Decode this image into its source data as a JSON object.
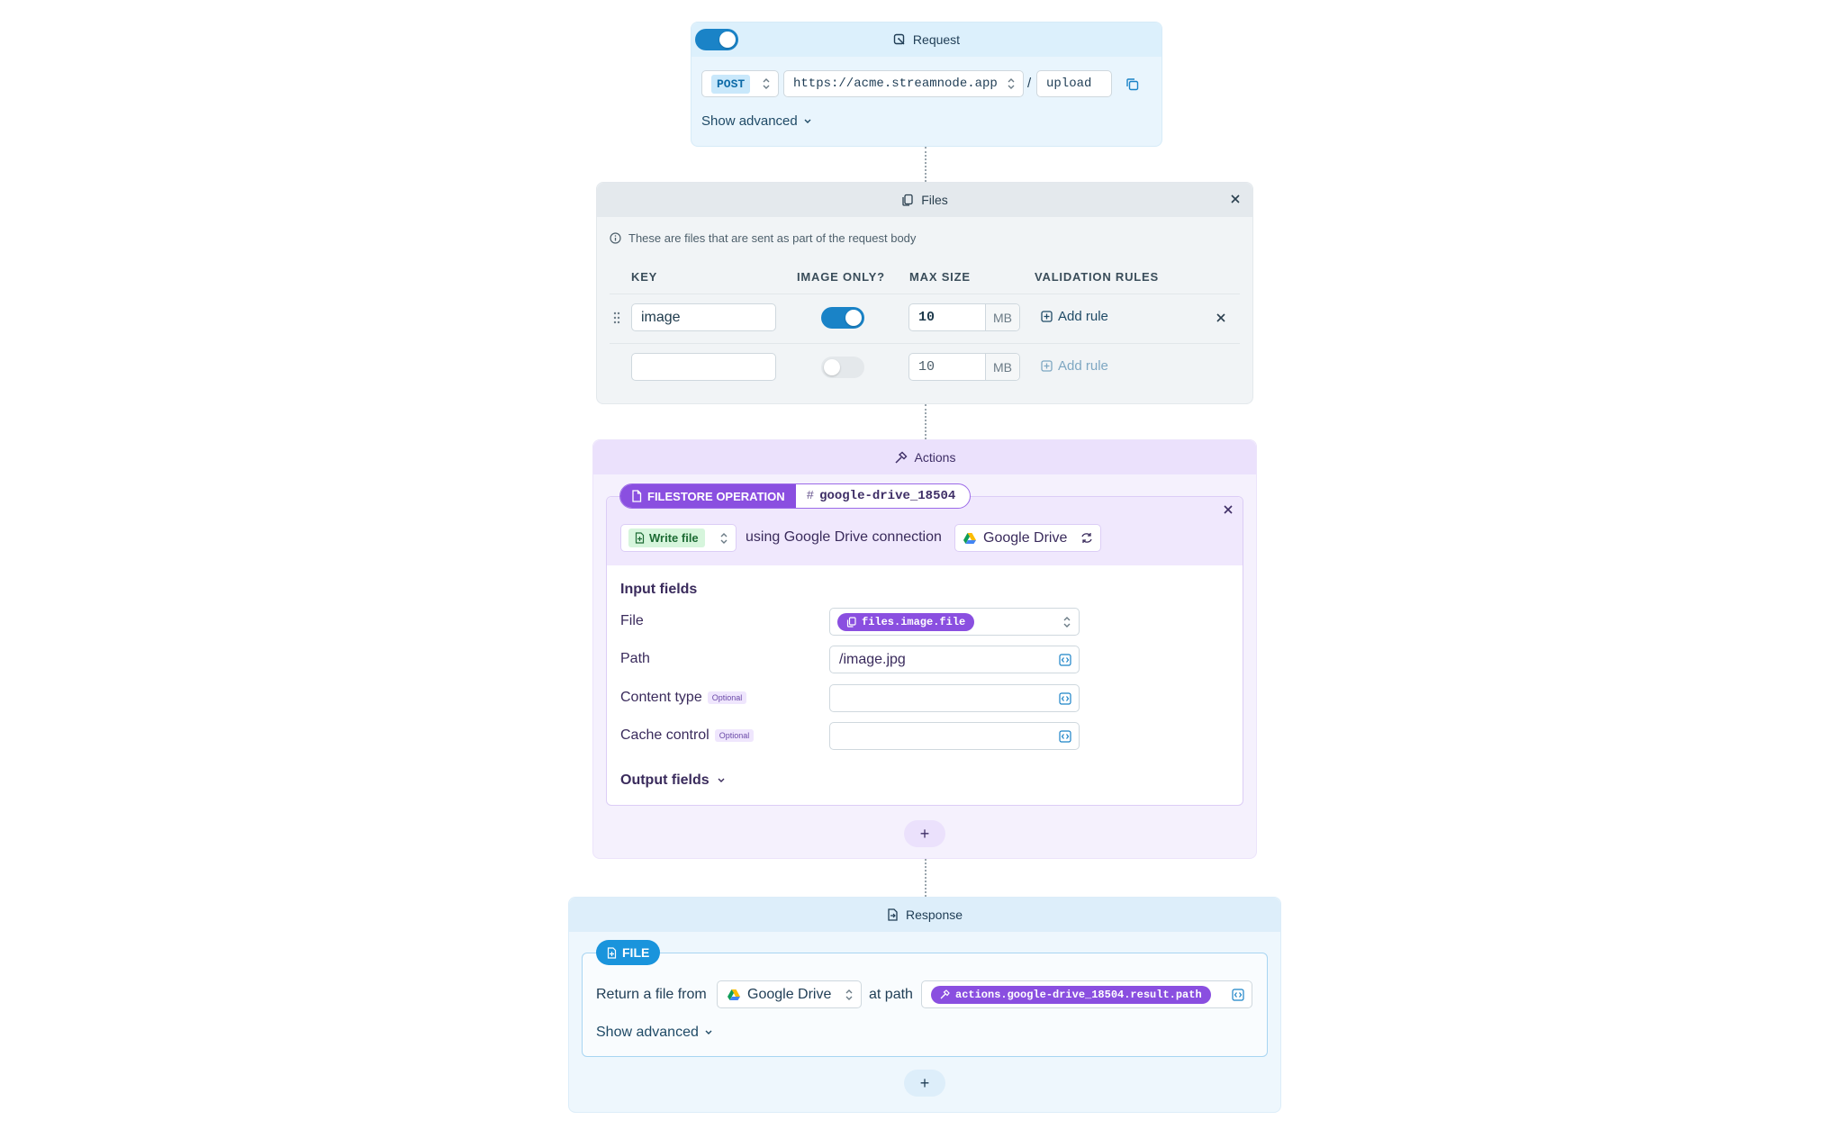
{
  "request": {
    "title": "Request",
    "enabled": true,
    "method": "POST",
    "base_url": "https://acme.streamnode.app",
    "separator": "/",
    "path": "upload",
    "show_advanced": "Show advanced"
  },
  "files": {
    "title": "Files",
    "info": "These are files that are sent as part of the request body",
    "columns": [
      "KEY",
      "IMAGE ONLY?",
      "MAX SIZE",
      "VALIDATION RULES"
    ],
    "rows": [
      {
        "key": "image",
        "image_only": true,
        "max_size": "10",
        "unit": "MB",
        "add_rule": "Add rule"
      },
      {
        "key": "",
        "image_only": false,
        "max_size": "10",
        "unit": "MB",
        "add_rule": "Add rule"
      }
    ]
  },
  "actions": {
    "title": "Actions",
    "operation_label": "FILESTORE OPERATION",
    "operation_id": "google-drive_18504",
    "operation": "Write file",
    "connection_text": "using Google Drive connection",
    "connection": "Google Drive",
    "input_fields_title": "Input fields",
    "fields": [
      {
        "label": "File",
        "optional": "",
        "value": "files.image.file"
      },
      {
        "label": "Path",
        "optional": "",
        "value": "/image.jpg"
      },
      {
        "label": "Content type",
        "optional": "Optional",
        "value": ""
      },
      {
        "label": "Cache control",
        "optional": "Optional",
        "value": ""
      }
    ],
    "output_fields": "Output fields",
    "add": "+"
  },
  "response": {
    "title": "Response",
    "type": "FILE",
    "return_text": "Return a file from",
    "source": "Google Drive",
    "at_path": "at path",
    "path_var": "actions.google-drive_18504.result.path",
    "show_advanced": "Show advanced",
    "add": "+"
  },
  "colors": {
    "accent_blue": "#1a83c7",
    "accent_purple": "#8a4fe0",
    "add_rule_active": "#1f4a66",
    "add_rule_disabled": "#7ea7c2"
  }
}
